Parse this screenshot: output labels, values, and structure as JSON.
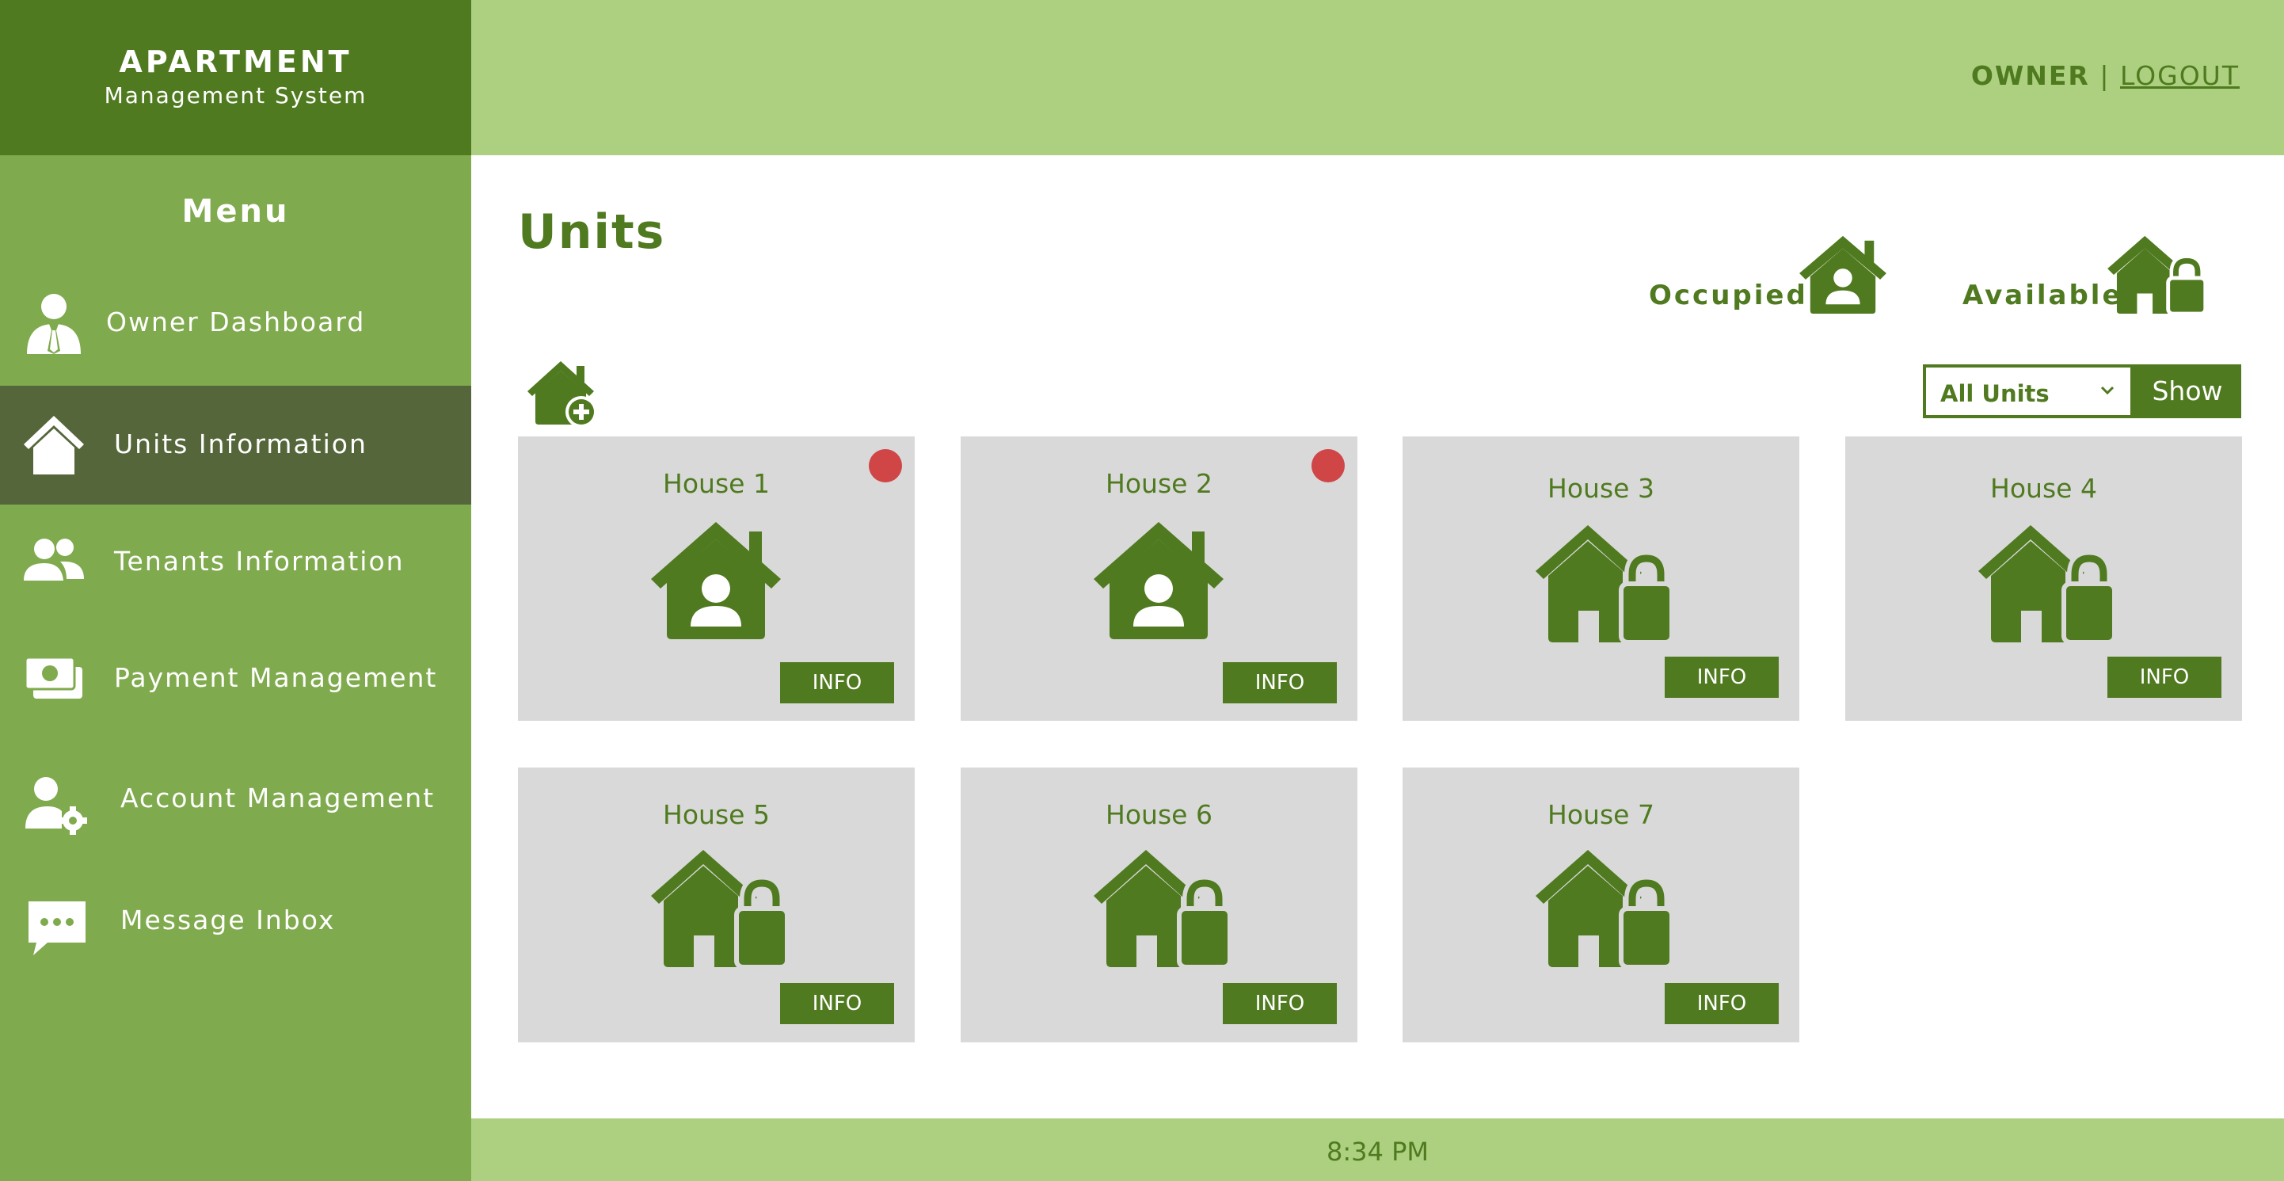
{
  "brand": {
    "title": "APARTMENT",
    "subtitle": "Management System"
  },
  "sidebar": {
    "menu_title": "Menu",
    "items": [
      {
        "label": "Owner Dashboard",
        "icon": "owner-icon"
      },
      {
        "label": "Units Information",
        "icon": "house-icon",
        "active": true
      },
      {
        "label": "Tenants Information",
        "icon": "users-icon"
      },
      {
        "label": "Payment Management",
        "icon": "money-icon"
      },
      {
        "label": "Account Management",
        "icon": "user-gear-icon"
      },
      {
        "label": "Message Inbox",
        "icon": "message-icon"
      }
    ]
  },
  "header": {
    "role": "OWNER",
    "separator": " | ",
    "logout": "LOGOUT"
  },
  "main": {
    "title": "Units",
    "legend": {
      "occupied": "Occupied",
      "available": "Available"
    },
    "filter": {
      "selected": "All Units",
      "show_label": "Show"
    },
    "units": [
      {
        "name": "House 1",
        "status": "occupied",
        "flag": true,
        "info": "INFO"
      },
      {
        "name": "House 2",
        "status": "occupied",
        "flag": true,
        "info": "INFO"
      },
      {
        "name": "House 3",
        "status": "available",
        "flag": false,
        "info": "INFO"
      },
      {
        "name": "House 4",
        "status": "available",
        "flag": false,
        "info": "INFO"
      },
      {
        "name": "House 5",
        "status": "available",
        "flag": false,
        "info": "INFO"
      },
      {
        "name": "House 6",
        "status": "available",
        "flag": false,
        "info": "INFO"
      },
      {
        "name": "House 7",
        "status": "available",
        "flag": false,
        "info": "INFO"
      }
    ]
  },
  "footer": {
    "time": "8:34 PM"
  },
  "colors": {
    "dark_green": "#4f7a1f",
    "sidebar_green": "#80aa4e",
    "light_green": "#acd080",
    "active_item": "#55663a",
    "card_bg": "#d9d9d9",
    "flag_red": "#d04545"
  }
}
